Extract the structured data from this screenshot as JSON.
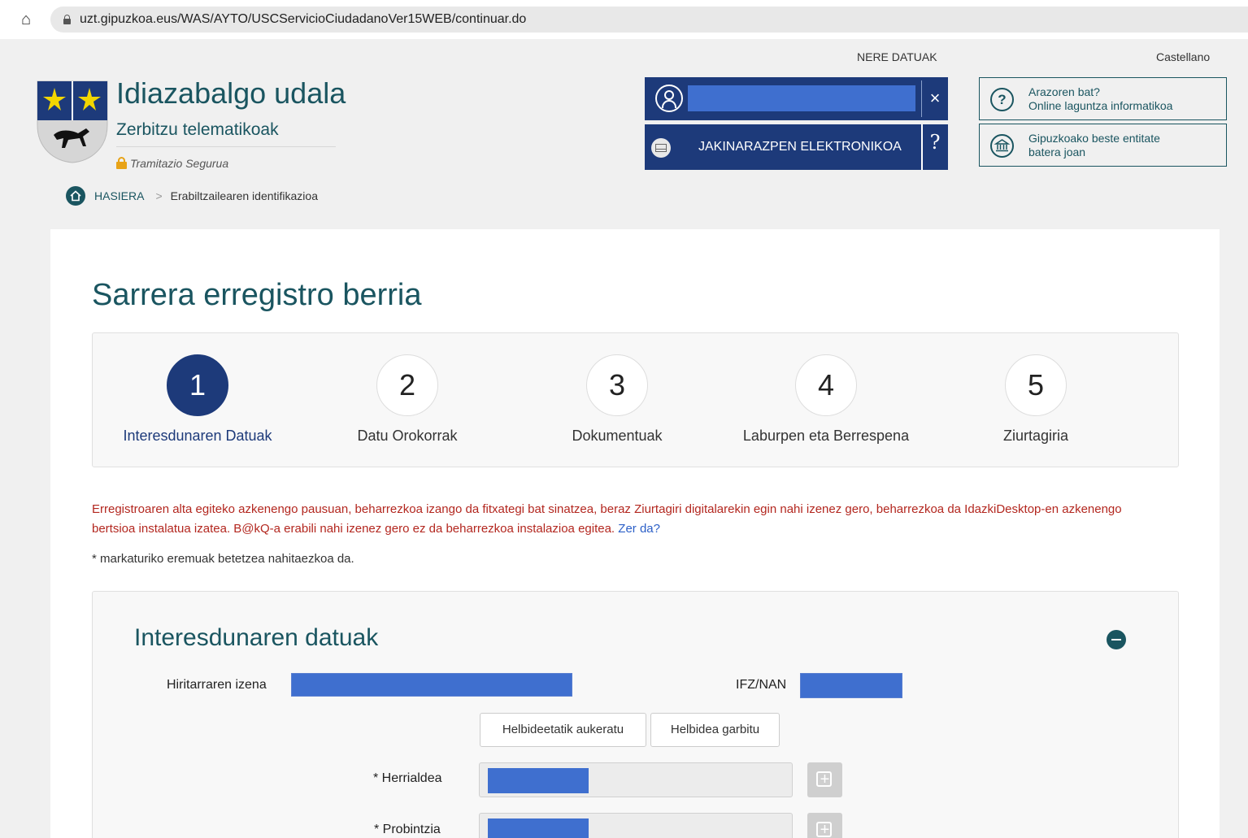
{
  "browser": {
    "url": "uzt.gipuzkoa.eus/WAS/AYTO/USCServicioCiudadanoVer15WEB/continuar.do"
  },
  "header": {
    "top_link_my_data": "NERE DATUAK",
    "top_link_language": "Castellano",
    "site_title": "Idiazabalgo udala",
    "site_subtitle": "Zerbitzu telematikoak",
    "secure_label": "Tramitazio Segurua",
    "breadcrumb": {
      "home": "HASIERA",
      "separator": ">",
      "current": "Erabiltzailearen identifikazioa"
    },
    "user_box": {
      "close_label": "×"
    },
    "notifications": {
      "label": "JAKINARAZPEN ELEKTRONIKOA",
      "help": "?"
    },
    "help_box": {
      "icon": "?",
      "line1": "Arazoren bat?",
      "line2": "Online laguntza informatikoa"
    },
    "entity_box": {
      "line1": "Gipuzkoako beste entitate",
      "line2": "batera joan"
    }
  },
  "main": {
    "title": "Sarrera erregistro berria",
    "steps": [
      {
        "number": "1",
        "label": "Interesdunaren Datuak",
        "active": true
      },
      {
        "number": "2",
        "label": "Datu Orokorrak",
        "active": false
      },
      {
        "number": "3",
        "label": "Dokumentuak",
        "active": false
      },
      {
        "number": "4",
        "label": "Laburpen eta Berrespena",
        "active": false
      },
      {
        "number": "5",
        "label": "Ziurtagiria",
        "active": false
      }
    ],
    "warning": "Erregistroaren alta egiteko azkenengo pausuan, beharrezkoa izango da fitxategi bat sinatzea, beraz Ziurtagiri digitalarekin egin nahi izenez gero, beharrezkoa da IdazkiDesktop-en azkenengo bertsioa instalatua izatea. B@kQ-a erabili nahi izenez gero ez da beharrezkoa instalazioa egitea.",
    "warning_link": "Zer da?",
    "required_note": "* markaturiko eremuak betetzea nahitaezkoa da.",
    "form": {
      "title": "Interesdunaren datuak",
      "citizen_name_label": "Hiritarraren izena",
      "id_label": "IFZ/NAN",
      "choose_address_button": "Helbideetatik aukeratu",
      "clear_address_button": "Helbidea garbitu",
      "country_label": "* Herrialdea",
      "province_label": "* Probintzia"
    }
  },
  "colors": {
    "brand_teal": "#1a5560",
    "brand_navy": "#1d3a7a",
    "warning_red": "#b3271f",
    "redaction_blue": "#3f6fcf"
  }
}
